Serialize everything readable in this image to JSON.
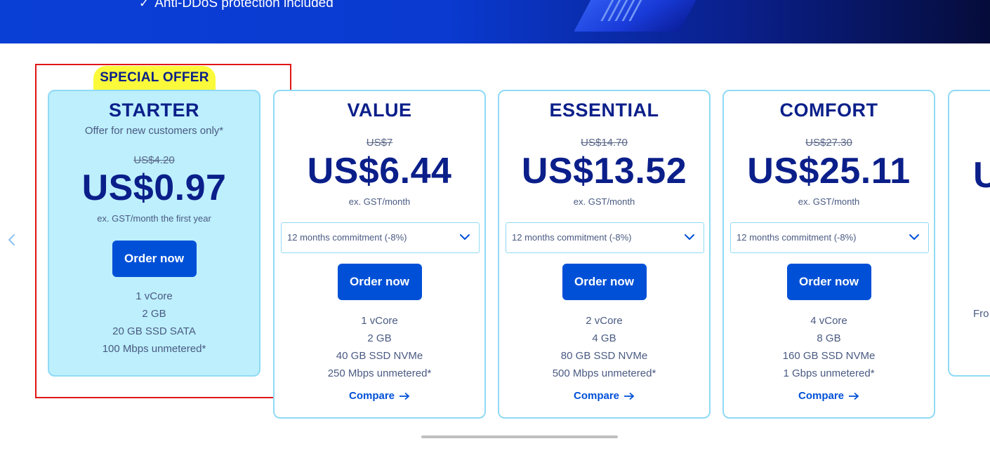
{
  "hero": {
    "feature_text": "Anti-DDoS protection included"
  },
  "carousel": {
    "prev_icon": "chevron-left-icon",
    "highlight_color": "#e01515"
  },
  "colors": {
    "accent": "#0050d7",
    "brand_dark": "#0b1f8a",
    "card_border": "#8fdaf5",
    "starter_bg": "#bdeffd",
    "badge_bg": "#fafa3a"
  },
  "starter": {
    "badge": "SPECIAL OFFER",
    "name": "STARTER",
    "note": "Offer for new customers only*",
    "old_price": "US$4.20",
    "price": "US$0.97",
    "price_note": "ex. GST/month the first year",
    "order_label": "Order now",
    "specs": [
      "1 vCore",
      "2 GB",
      "20 GB SSD SATA",
      "100 Mbps unmetered*"
    ]
  },
  "plans": [
    {
      "name": "VALUE",
      "old_price": "US$7",
      "price": "US$6.44",
      "price_note": "ex. GST/month",
      "commitment": "12 months commitment (-8%)",
      "order_label": "Order now",
      "specs": [
        "1 vCore",
        "2 GB",
        "40 GB SSD NVMe",
        "250 Mbps unmetered*"
      ],
      "compare_label": "Compare"
    },
    {
      "name": "ESSENTIAL",
      "old_price": "US$14.70",
      "price": "US$13.52",
      "price_note": "ex. GST/month",
      "commitment": "12 months commitment (-8%)",
      "order_label": "Order now",
      "specs": [
        "2 vCore",
        "4 GB",
        "80 GB SSD NVMe",
        "500 Mbps unmetered*"
      ],
      "compare_label": "Compare"
    },
    {
      "name": "COMFORT",
      "old_price": "US$27.30",
      "price": "US$25.11",
      "price_note": "ex. GST/month",
      "commitment": "12 months commitment (-8%)",
      "order_label": "Order now",
      "specs": [
        "4 vCore",
        "8 GB",
        "160 GB SSD NVMe",
        "1 Gbps unmetered*"
      ],
      "compare_label": "Compare"
    }
  ],
  "partial_card": {
    "price": "U",
    "from_text": "Fro"
  }
}
